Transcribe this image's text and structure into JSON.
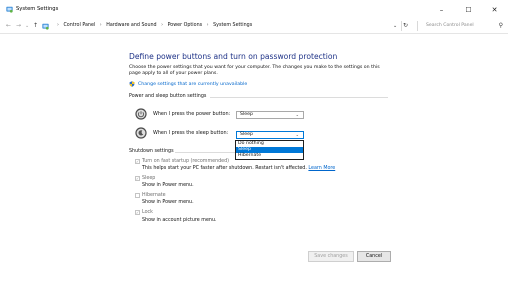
{
  "window": {
    "title": "System Settings",
    "minimize_glyph": "–",
    "maximize_glyph": "☐",
    "close_glyph": "✕"
  },
  "address": {
    "back_glyph": "←",
    "forward_glyph": "→",
    "recent_glyph": "⌄",
    "up_glyph": "↑",
    "crumbs": [
      "Control Panel",
      "Hardware and Sound",
      "Power Options",
      "System Settings"
    ],
    "separator": "›",
    "dropdown_glyph": "⌄",
    "refresh_glyph": "↻",
    "search_placeholder": "Search Control Panel",
    "search_glyph": "⚲"
  },
  "main": {
    "heading": "Define power buttons and turn on password protection",
    "description": "Choose the power settings that you want for your computer. The changes you make to the settings on this page apply to all of your power plans.",
    "unavailable_link": "Change settings that are currently unavailable"
  },
  "power_group": {
    "label": "Power and sleep button settings",
    "power_button": {
      "label": "When I press the power button:",
      "value": "Sleep"
    },
    "sleep_button": {
      "label": "When I press the sleep button:",
      "value": "Sleep"
    }
  },
  "dropdown": {
    "options": [
      "Do nothing",
      "Sleep",
      "Hibernate"
    ],
    "selected_index": 1
  },
  "shutdown_group": {
    "label": "Shutdown settings",
    "items": [
      {
        "label": "Turn on fast startup (recommended)",
        "checked": true,
        "desc": "This helps start your PC faster after shutdown. Restart isn't affected.",
        "link": "Learn More"
      },
      {
        "label": "Sleep",
        "checked": true,
        "desc": "Show in Power menu."
      },
      {
        "label": "Hibernate",
        "checked": false,
        "desc": "Show in Power menu."
      },
      {
        "label": "Lock",
        "checked": true,
        "desc": "Show in account picture menu."
      }
    ]
  },
  "footer": {
    "save_label": "Save changes",
    "cancel_label": "Cancel"
  },
  "colors": {
    "heading": "#1e3287",
    "link": "#0066cc",
    "selection": "#0078d7"
  }
}
